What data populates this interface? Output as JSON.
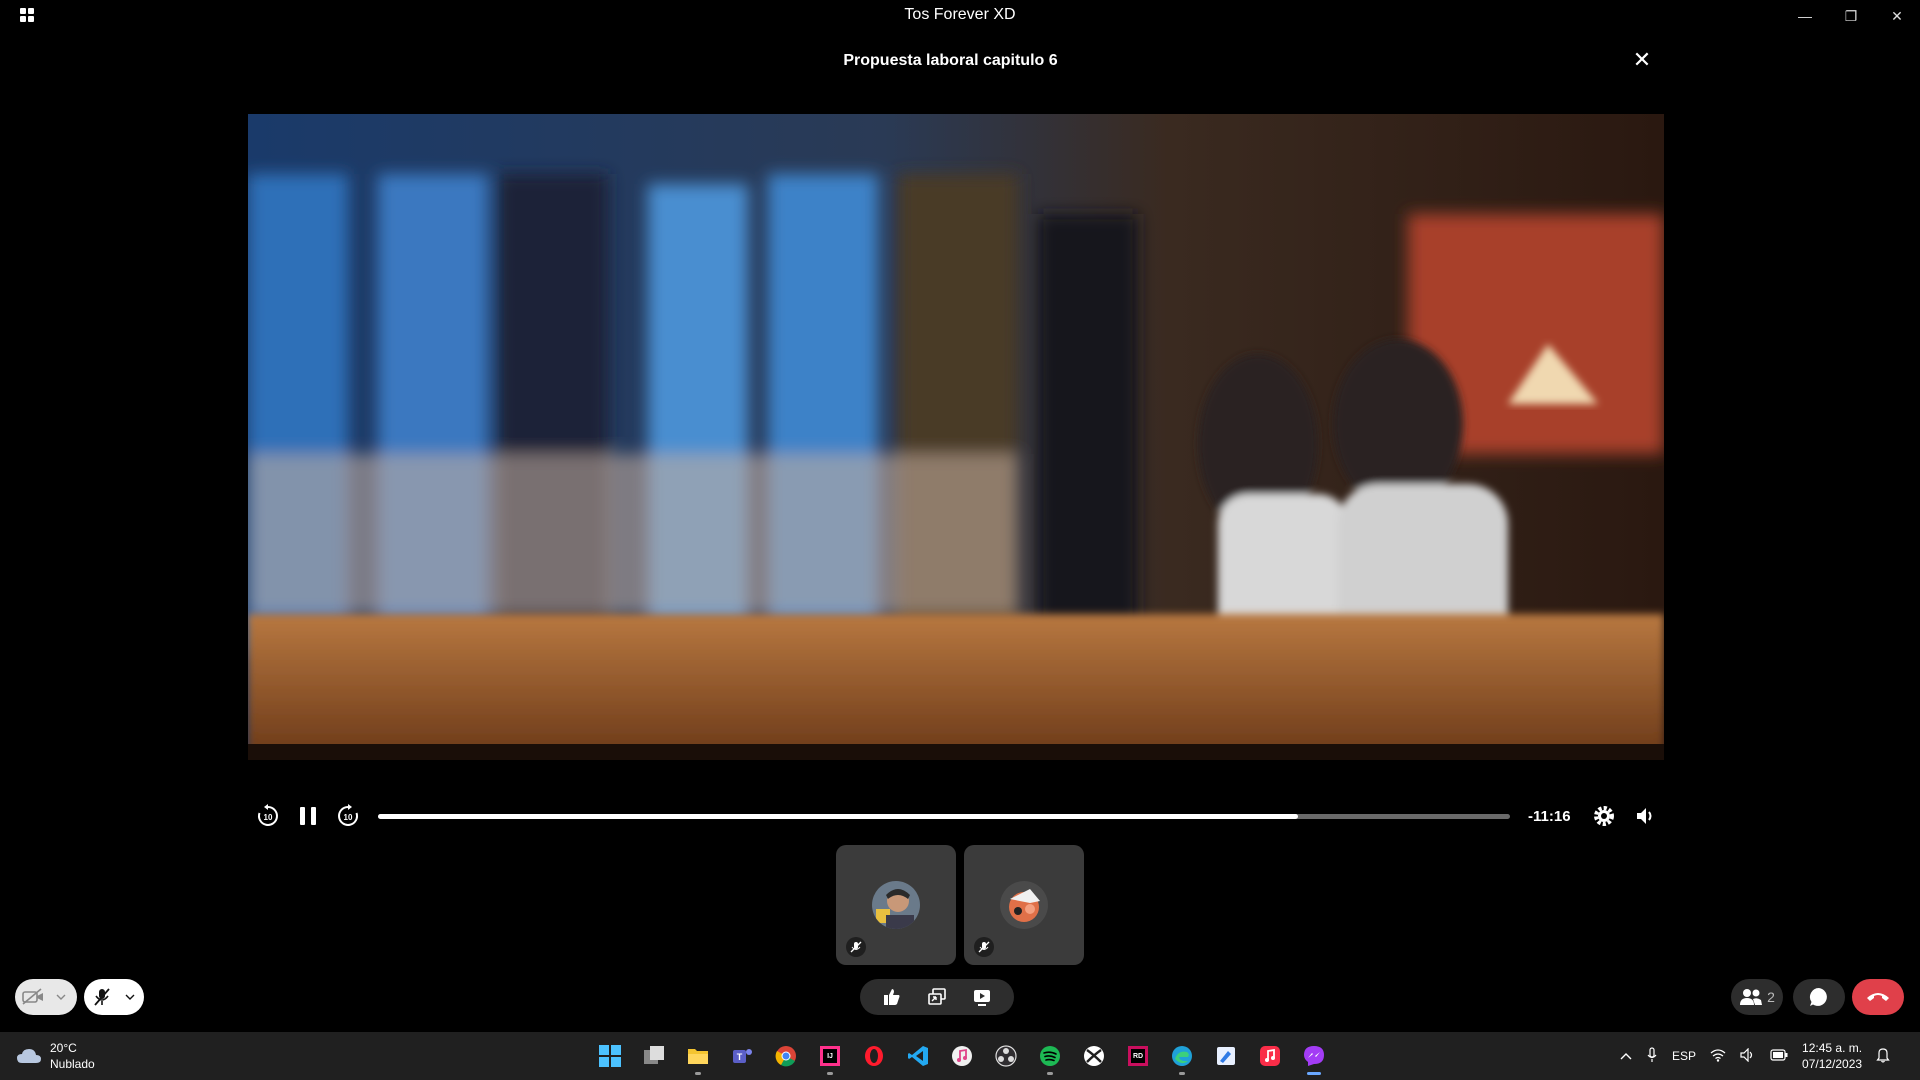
{
  "window": {
    "title": "Tos Forever XD",
    "minimize_glyph": "—",
    "maximize_glyph": "❐",
    "close_glyph": "✕"
  },
  "video": {
    "title": "Propuesta laboral capitulo 6",
    "close_glyph": "✕",
    "remaining_time": "-11:16",
    "progress": 0.813
  },
  "controls": {
    "icons": [
      "rewind-10-icon",
      "pause-icon",
      "forward-10-icon",
      "settings-gear-icon",
      "volume-icon"
    ]
  },
  "participants": [
    {
      "name_icon": "avatar-participant-1",
      "muted": true
    },
    {
      "name_icon": "avatar-participant-2",
      "muted": true
    }
  ],
  "call_bar": {
    "people_count": "2",
    "end_call_color": "#e0404a"
  },
  "taskbar": {
    "weather_temp": "20°C",
    "weather_desc": "Nublado",
    "language": "ESP",
    "time": "12:45 a. m.",
    "date": "07/12/2023",
    "apps": [
      "windows-start-icon",
      "task-view-icon",
      "file-explorer-icon",
      "teams-icon",
      "chrome-icon",
      "jetbrains-icon",
      "opera-icon",
      "vscode-icon",
      "itunes-icon",
      "obs-icon",
      "spotify-icon",
      "xbox-icon",
      "rider-icon",
      "edge-icon",
      "paint-icon",
      "apple-music-icon",
      "messenger-icon"
    ]
  }
}
